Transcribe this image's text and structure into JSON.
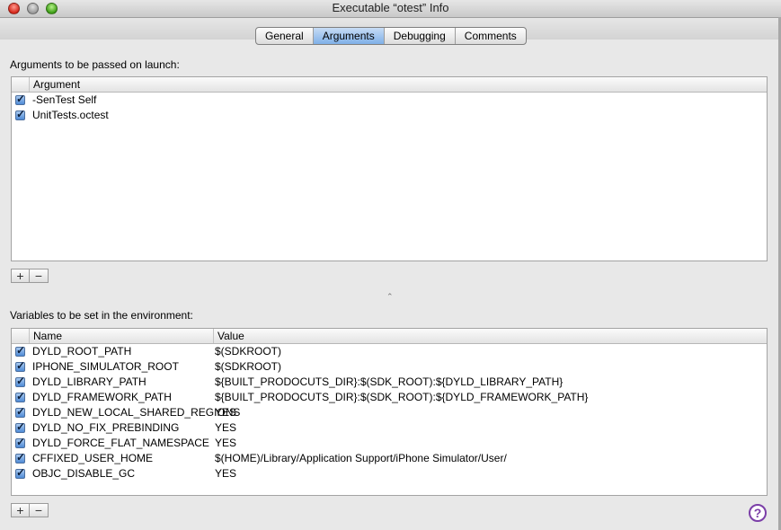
{
  "window": {
    "title": "Executable “otest” Info"
  },
  "tabs": [
    {
      "label": "General"
    },
    {
      "label": "Arguments"
    },
    {
      "label": "Debugging"
    },
    {
      "label": "Comments"
    }
  ],
  "arguments": {
    "section_label": "Arguments to be passed on launch:",
    "column_header": "Argument",
    "rows": [
      {
        "checked": true,
        "value": "-SenTest Self"
      },
      {
        "checked": true,
        "value": "UnitTests.octest"
      }
    ]
  },
  "environment": {
    "section_label": "Variables to be set in the environment:",
    "columns": {
      "name": "Name",
      "value": "Value"
    },
    "rows": [
      {
        "checked": true,
        "name": "DYLD_ROOT_PATH",
        "value": "$(SDKROOT)"
      },
      {
        "checked": true,
        "name": "IPHONE_SIMULATOR_ROOT",
        "value": "$(SDKROOT)"
      },
      {
        "checked": true,
        "name": "DYLD_LIBRARY_PATH",
        "value": "${BUILT_PRODOCUTS_DIR}:$(SDK_ROOT):${DYLD_LIBRARY_PATH}"
      },
      {
        "checked": true,
        "name": "DYLD_FRAMEWORK_PATH",
        "value": "${BUILT_PRODOCUTS_DIR}:$(SDK_ROOT):${DYLD_FRAMEWORK_PATH}"
      },
      {
        "checked": true,
        "name": "DYLD_NEW_LOCAL_SHARED_REGIONS",
        "value": "YES"
      },
      {
        "checked": true,
        "name": "DYLD_NO_FIX_PREBINDING",
        "value": "YES"
      },
      {
        "checked": true,
        "name": "DYLD_FORCE_FLAT_NAMESPACE",
        "value": "YES"
      },
      {
        "checked": true,
        "name": "CFFIXED_USER_HOME",
        "value": "$(HOME)/Library/Application Support/iPhone Simulator/User/"
      },
      {
        "checked": true,
        "name": "OBJC_DISABLE_GC",
        "value": "YES"
      }
    ]
  },
  "buttons": {
    "add": "+",
    "remove": "−"
  },
  "help": {
    "label": "?"
  }
}
